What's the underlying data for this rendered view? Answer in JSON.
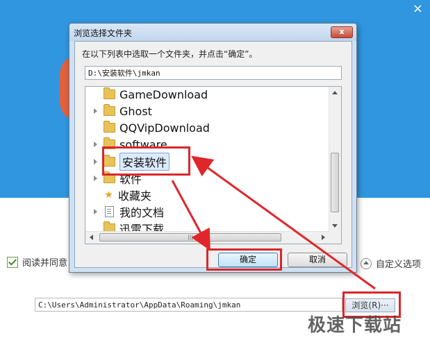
{
  "installer": {
    "close_glyph": "×",
    "agree_label": "阅读并同意",
    "custom_option_label": "自定义选项",
    "install_path": "C:\\Users\\Administrator\\AppData\\Roaming\\jmkan",
    "browse_label": "浏览(R)···"
  },
  "watermark": "极速下载站",
  "dialog": {
    "title": "浏览选择文件夹",
    "close_glyph": "x",
    "instruction": "在以下列表中选取一个文件夹，并点击“确定”。",
    "folder_path": "D:\\安装软件\\jmkan",
    "tree_items": [
      {
        "label": "GameDownload",
        "icon": "folder-icon",
        "expandable": false
      },
      {
        "label": "Ghost",
        "icon": "folder-icon",
        "expandable": true
      },
      {
        "label": "QQVipDownload",
        "icon": "folder-icon",
        "expandable": false
      },
      {
        "label": "software",
        "icon": "folder-icon",
        "expandable": true
      },
      {
        "label": "安装软件",
        "icon": "folder-icon",
        "expandable": true,
        "selected": true
      },
      {
        "label": "软件",
        "icon": "folder-icon",
        "expandable": true
      },
      {
        "label": "收藏夹",
        "icon": "star-icon",
        "expandable": false
      },
      {
        "label": "我的文档",
        "icon": "document-icon",
        "expandable": true
      },
      {
        "label": "迅雷下载",
        "icon": "folder-icon",
        "expandable": false
      }
    ],
    "ok_label": "确定",
    "cancel_label": "取消"
  },
  "colors": {
    "installer_blue": "#2f96df",
    "highlight_red": "#d9262b",
    "orange_accent": "#e0613e"
  }
}
